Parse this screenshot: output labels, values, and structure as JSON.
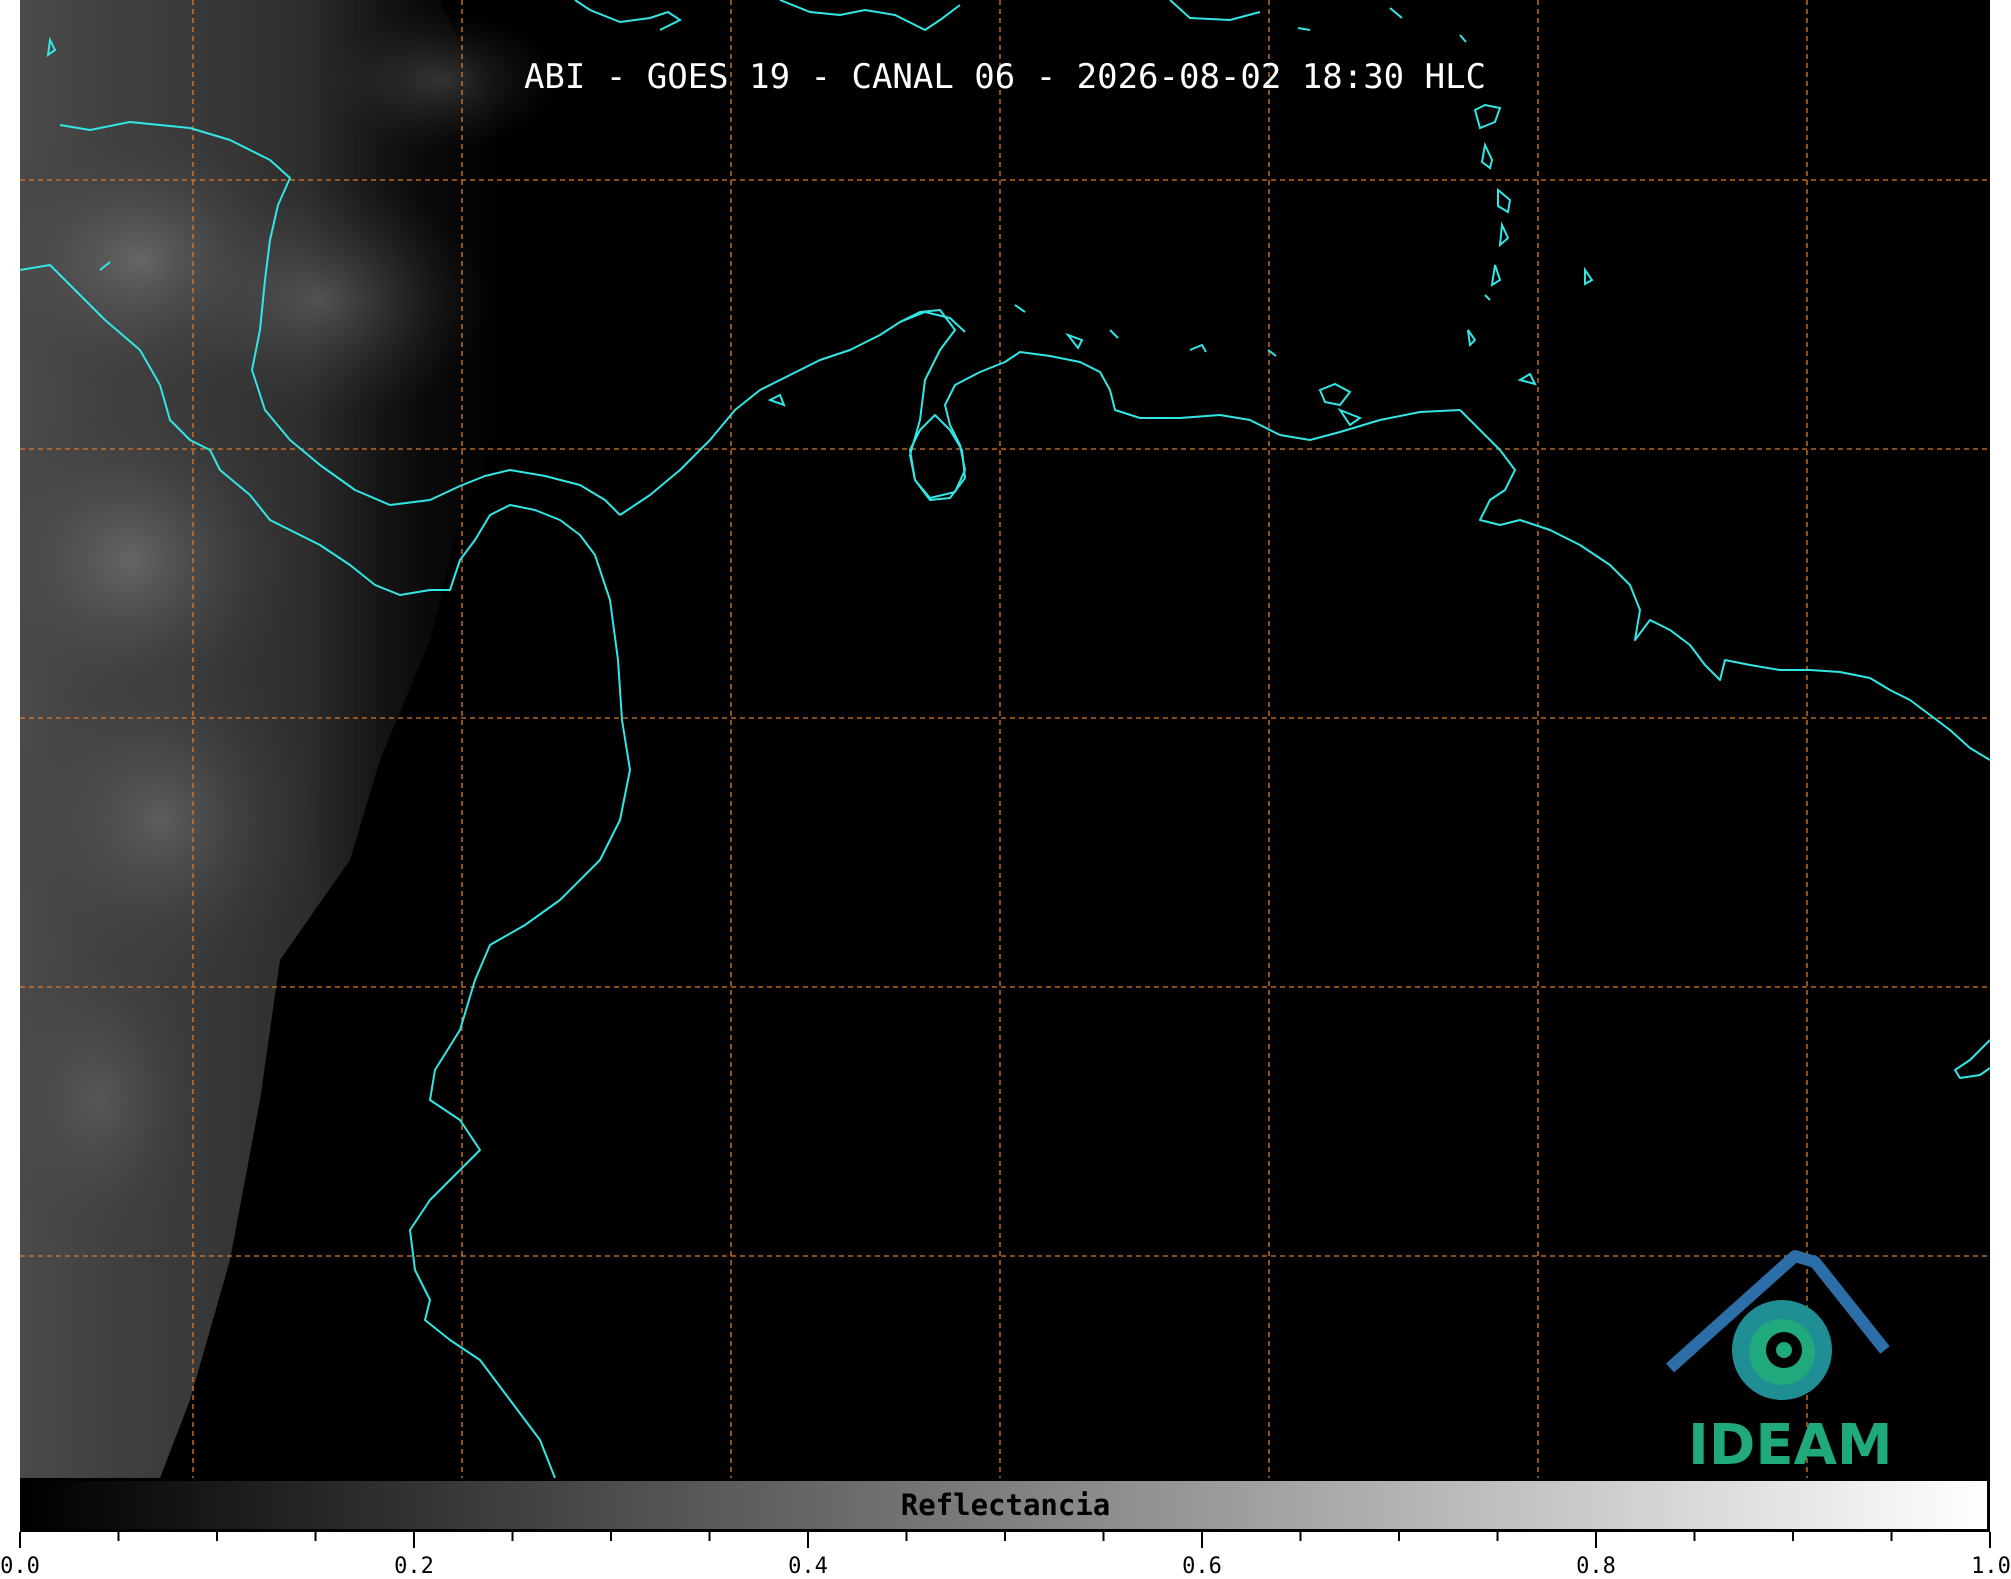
{
  "map": {
    "title": "ABI - GOES 19 - CANAL 06 - 2026-08-02 18:30 HLC",
    "background": "#000000",
    "coastline_color": "#33e6e6",
    "graticule_color": "#e07a2a",
    "icons": [
      "ideam-logo"
    ]
  },
  "logo": {
    "name": "IDEAM",
    "colors": [
      "#2c5aa0",
      "#1fa97c"
    ]
  },
  "colorbar": {
    "label": "Reflectancia",
    "range": [
      0.0,
      1.0
    ],
    "gradient": [
      "#000000",
      "#ffffff"
    ],
    "tick_labels": [
      "0.0",
      "0.2",
      "0.4",
      "0.6",
      "0.8",
      "1.0"
    ]
  }
}
